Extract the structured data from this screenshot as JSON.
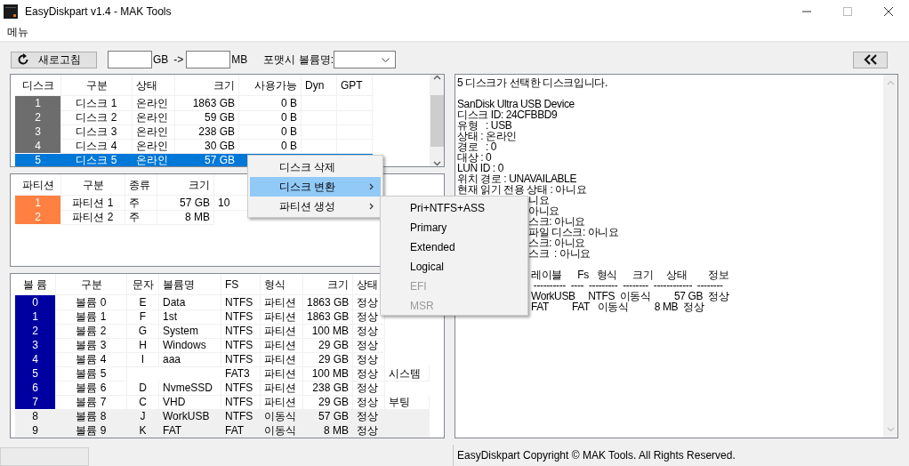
{
  "window": {
    "title": "EasyDiskpart v1.4 - MAK Tools"
  },
  "menu_bar": [
    "메뉴"
  ],
  "toolbar": {
    "refresh_button": "새로고침",
    "size_from_unit": "GB",
    "arrow": "->",
    "size_to_unit": "MB",
    "format_label": "포맷시 볼륨명:"
  },
  "disks": {
    "columns": [
      "디스크",
      "구분",
      "상태",
      "크기",
      "사용가능",
      "Dyn",
      "GPT"
    ],
    "rows": [
      {
        "cells": [
          "1",
          "디스크 1",
          "온라인",
          "1863 GB",
          "0 B"
        ],
        "selected": false
      },
      {
        "cells": [
          "2",
          "디스크 2",
          "온라인",
          "59 GB",
          "0 B"
        ],
        "selected": false
      },
      {
        "cells": [
          "3",
          "디스크 3",
          "온라인",
          "238 GB",
          "0 B"
        ],
        "selected": false
      },
      {
        "cells": [
          "4",
          "디스크 4",
          "온라인",
          "30 GB",
          "0 B"
        ],
        "selected": false
      },
      {
        "cells": [
          "5",
          "디스크 5",
          "온라인",
          "57 GB"
        ],
        "selected": true
      }
    ]
  },
  "partitions": {
    "columns": [
      "파티션",
      "구분",
      "종류",
      "크기"
    ],
    "rows": [
      {
        "cells": [
          "1",
          "파티션 1",
          "주",
          "57 GB",
          "10"
        ]
      },
      {
        "cells": [
          "2",
          "파티션 2",
          "주",
          "8 MB"
        ]
      }
    ]
  },
  "volumes": {
    "columns": [
      "볼  륨",
      "구분",
      "문자",
      "볼륨명",
      "FS",
      "형식",
      "크기",
      "상태"
    ],
    "rows": [
      {
        "kind": "fixed",
        "cells": [
          "0",
          "볼륨 0",
          "E",
          "Data",
          "NTFS",
          "파티션",
          "1863 GB",
          "정상"
        ]
      },
      {
        "kind": "fixed",
        "cells": [
          "1",
          "볼륨 1",
          "F",
          "1st",
          "NTFS",
          "파티션",
          "1863 GB",
          "정상"
        ]
      },
      {
        "kind": "fixed",
        "cells": [
          "2",
          "볼륨 2",
          "G",
          "System",
          "NTFS",
          "파티션",
          "100 MB",
          "정상"
        ]
      },
      {
        "kind": "fixed",
        "cells": [
          "3",
          "볼륨 3",
          "H",
          "Windows",
          "NTFS",
          "파티션",
          "29 GB",
          "정상"
        ]
      },
      {
        "kind": "fixed",
        "cells": [
          "4",
          "볼륨 4",
          "I",
          "aaa",
          "NTFS",
          "파티션",
          "29 GB",
          "정상"
        ]
      },
      {
        "kind": "fixed",
        "cells": [
          "5",
          "볼륨 5",
          null,
          null,
          "FAT3",
          "파티션",
          "100 MB",
          "정상",
          "시스템"
        ]
      },
      {
        "kind": "fixed",
        "cells": [
          "6",
          "볼륨 6",
          "D",
          "NvmeSSD",
          "NTFS",
          "파티션",
          "238 GB",
          "정상"
        ]
      },
      {
        "kind": "fixed",
        "cells": [
          "7",
          "볼륨 7",
          "C",
          "VHD",
          "NTFS",
          "파티션",
          "29 GB",
          "정상",
          "부팅"
        ]
      },
      {
        "kind": "removable",
        "cells": [
          "8",
          "볼륨 8",
          "J",
          "WorkUSB",
          "NTFS",
          "이동식",
          "57 GB",
          "정상"
        ]
      },
      {
        "kind": "removable",
        "cells": [
          "9",
          "볼륨 9",
          "K",
          "FAT",
          "FAT",
          "이동식",
          "8 MB",
          "정상"
        ]
      }
    ]
  },
  "info_lines": [
    {
      "kind": "full",
      "text": "5 디스크가 선택한 디스크입니다."
    },
    {
      "kind": "blank"
    },
    {
      "kind": "full",
      "text": "SanDisk Ultra USB Device"
    },
    {
      "kind": "full",
      "text": "디스크 ID: 24CFBBD9"
    },
    {
      "kind": "full",
      "text": "유형   : USB"
    },
    {
      "kind": "full",
      "text": "상태 : 온라인"
    },
    {
      "kind": "full",
      "text": "경로   : 0"
    },
    {
      "kind": "full",
      "text": "대상 : 0"
    },
    {
      "kind": "full",
      "text": "LUN ID : 0"
    },
    {
      "kind": "full",
      "text": "위치 경로 : UNAVAILABLE"
    },
    {
      "kind": "full",
      "text": "현재 읽기 전용 상태 : 아니요"
    },
    {
      "kind": "clipped",
      "text": "니요"
    },
    {
      "kind": "clipped",
      "text": "아니요"
    },
    {
      "kind": "clipped",
      "text": "스크: 아니요"
    },
    {
      "kind": "clipped",
      "text": "파일 디스크: 아니요"
    },
    {
      "kind": "clipped",
      "text": "스크: 아니요"
    },
    {
      "kind": "clipped",
      "text": "스크  : 아니요"
    },
    {
      "kind": "blank"
    },
    {
      "kind": "clipped",
      "text": " 레이블      Fs   형식      크기     상태        정보"
    },
    {
      "kind": "clipped",
      "text": "  ----------  ----  ---------  --------  ------------  --------"
    },
    {
      "kind": "clipped",
      "text": " WorkUSB     NTFS  이동식         57 GB  정상"
    },
    {
      "kind": "clipped",
      "text": " FAT         FAT   이동식          8 MB  정상"
    }
  ],
  "context_menu": [
    {
      "label": "디스크 삭제",
      "selected": false,
      "submenu": false
    },
    {
      "label": "디스크 변환",
      "selected": true,
      "submenu": true
    },
    {
      "label": "파티션 생성",
      "selected": false,
      "submenu": true
    }
  ],
  "submenu": [
    {
      "label": "Pri+NTFS+ASS",
      "disabled": false
    },
    {
      "label": "Primary",
      "disabled": false
    },
    {
      "label": "Extended",
      "disabled": false
    },
    {
      "label": "Logical",
      "disabled": false
    },
    {
      "label": "EFI",
      "disabled": true
    },
    {
      "label": "MSR",
      "disabled": true
    }
  ],
  "status_bar": "EasyDiskpart Copyright © MAK Tools. All Rights Reserved."
}
